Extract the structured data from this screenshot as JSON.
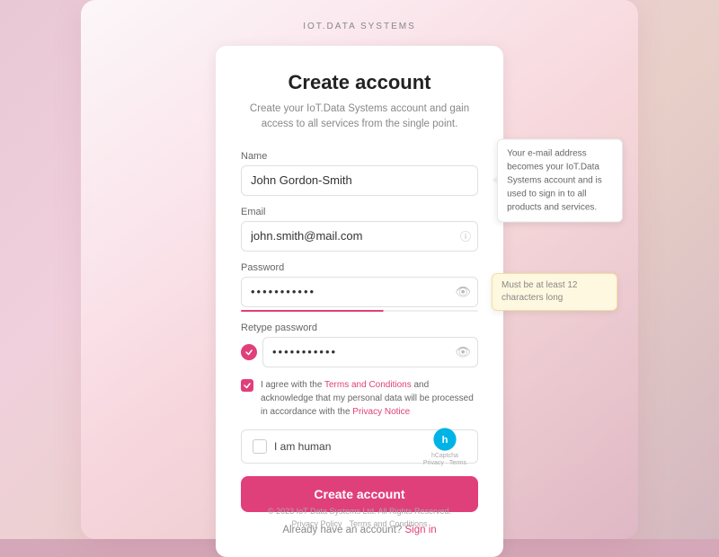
{
  "brand": {
    "logo": "IOT.DATA SYSTEMS"
  },
  "form": {
    "title": "Create account",
    "subtitle": "Create your IoT.Data Systems account and gain\naccess to all services from the single point.",
    "name_label": "Name",
    "name_value": "John Gordon-Smith",
    "email_label": "Email",
    "email_value": "john.smith@mail.com",
    "password_label": "Password",
    "password_value": "••••••••",
    "retype_label": "Retype password",
    "retype_value": "••••••••",
    "agree_text": "I agree with the ",
    "agree_link_terms": "Terms and Conditions",
    "agree_middle": " and acknowledge that my personal data will be processed in accordance with the ",
    "agree_link_privacy": "Privacy Notice",
    "captcha_label": "I am human",
    "captcha_logo_text": "hCaptcha\nPrivacy · Terms",
    "create_button": "Create account",
    "signin_text": "Already have an account?",
    "signin_link": "Sign in"
  },
  "tooltips": {
    "email_tooltip": "Your e-mail address becomes your IoT.Data Systems account and is used to sign in to all products and services.",
    "password_tooltip": "Must be at least 12 characters long"
  },
  "footer": {
    "copyright": "© 2023 IoT Data Systems Ltd. All Rights Reserved.",
    "privacy": "Privacy Policy",
    "terms": "Terms and Conditions"
  }
}
